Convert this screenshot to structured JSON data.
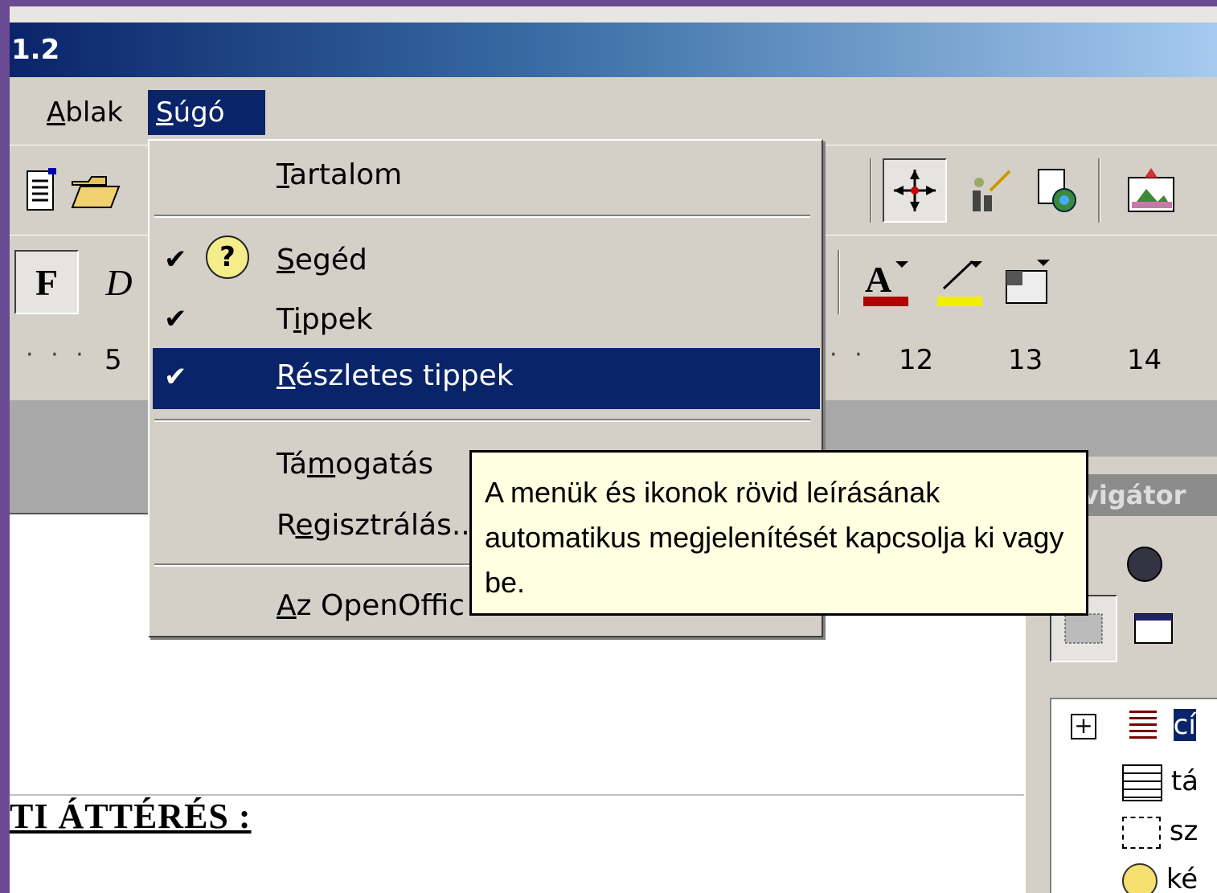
{
  "window": {
    "title": "1.2"
  },
  "menubar": {
    "items": [
      {
        "label": "Ablak",
        "accel": "A"
      },
      {
        "label": "Súgó",
        "accel": "S"
      }
    ]
  },
  "help_menu": {
    "items": [
      {
        "label": "Tartalom",
        "accel": "T",
        "checked": false
      },
      {
        "label": "Segéd",
        "accel": "S",
        "checked": true,
        "icon": "question-icon"
      },
      {
        "label": "Tippek",
        "accel": "i",
        "checked": true
      },
      {
        "label": "Részletes tippek",
        "accel": "R",
        "checked": true,
        "highlighted": true
      },
      {
        "label": "Támogatás",
        "accel": "m",
        "checked": false
      },
      {
        "label": "Regisztrálás...",
        "accel": "e",
        "checked": false
      },
      {
        "label": "Az OpenOffic",
        "accel": "A",
        "checked": false
      }
    ]
  },
  "tooltip": {
    "text": "A menük és ikonok rövid leírásának automatikus megjelenítését kapcsolja ki vagy be."
  },
  "toolbar_format": {
    "bold_label": "F",
    "italic_label": "D"
  },
  "ruler": {
    "labels": [
      "5",
      "12",
      "13",
      "14"
    ]
  },
  "navigator": {
    "title": "vigátor",
    "tree": [
      "cí",
      "tá",
      "sz",
      "ké"
    ]
  },
  "document": {
    "heading": "TI ÁTTÉRÉS :"
  },
  "colors": {
    "titlebar": "#0a246a",
    "highlight": "#0a246a",
    "tooltip_bg": "#ffffe1",
    "menu_bg": "#d4d0c8"
  }
}
